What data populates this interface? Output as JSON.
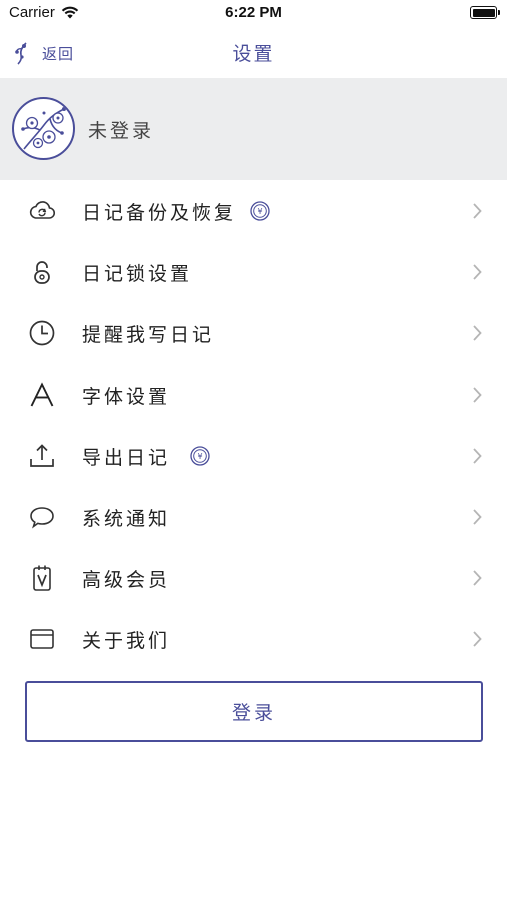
{
  "status_bar": {
    "carrier": "Carrier",
    "time": "6:22 PM"
  },
  "nav": {
    "back_label": "返回",
    "title": "设置"
  },
  "profile": {
    "name": "未登录"
  },
  "menu": {
    "items": [
      {
        "label": "日记备份及恢复",
        "icon": "cloud-sync-icon",
        "premium": true
      },
      {
        "label": "日记锁设置",
        "icon": "lock-icon",
        "premium": false
      },
      {
        "label": "提醒我写日记",
        "icon": "clock-icon",
        "premium": false
      },
      {
        "label": "字体设置",
        "icon": "font-icon",
        "premium": false
      },
      {
        "label": "导出日记",
        "icon": "export-icon",
        "premium": true
      },
      {
        "label": "系统通知",
        "icon": "chat-bubble-icon",
        "premium": false
      },
      {
        "label": "高级会员",
        "icon": "vip-card-icon",
        "premium": false
      },
      {
        "label": "关于我们",
        "icon": "window-icon",
        "premium": false
      }
    ]
  },
  "login_button": {
    "label": "登录"
  },
  "colors": {
    "accent": "#4a4e9a",
    "profile_bg": "#ecedee",
    "chevron": "#b5b5b5"
  }
}
